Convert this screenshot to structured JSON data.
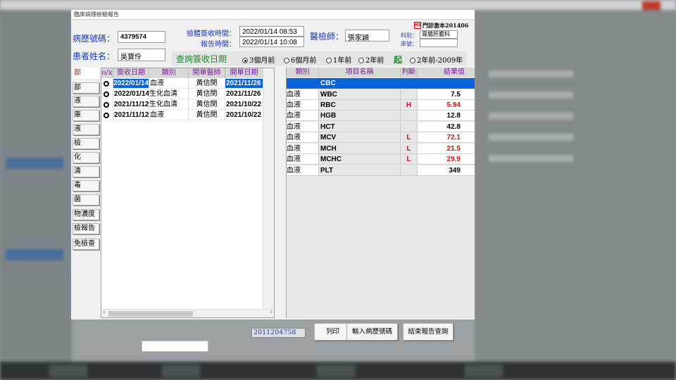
{
  "window": {
    "title": "臨床病理檢驗報告"
  },
  "patient": {
    "chart_no_label": "病歷號碼：",
    "chart_no": "4379574",
    "name_label": "患者姓名：",
    "name": "吳寶伶"
  },
  "times": {
    "received_label": "檢體簽收時間：",
    "received": "2022/01/14 08:53",
    "report_label": "報告時間：",
    "report": "2022/01/14 10:08"
  },
  "doctor": {
    "label": "醫檢師：",
    "value": "張家穎"
  },
  "clinic": {
    "badge": "HS",
    "version": "門診激本201406",
    "dept_label": "科別：",
    "dept": "胃腸肝膽科",
    "bed_label": "床號：",
    "bed": ""
  },
  "query": {
    "title": "查詢簽收日期",
    "options": [
      "3個月前",
      "6個月前",
      "1年前",
      "2年前"
    ],
    "from_label": "起",
    "option_old": "2年前-2009年",
    "selected_index": 0
  },
  "categories": [
    "部",
    "部",
    "液",
    "庫",
    "液",
    "檢",
    "化",
    "清",
    "毒",
    "菌",
    "物濃度",
    "檢報告",
    "免檢查"
  ],
  "left_grid": {
    "headers": [
      "o/x",
      "簽收日期",
      "類別",
      "開單醫師",
      "開單日期"
    ],
    "rows": [
      {
        "mark": "",
        "date": "2022/01/14",
        "type": "血液",
        "doctor": "黃信閔",
        "order_date": "2021/11/26"
      },
      {
        "mark": "",
        "date": "2022/01/14",
        "type": "生化血清",
        "doctor": "黃信閔",
        "order_date": "2021/11/26"
      },
      {
        "mark": "",
        "date": "2021/11/12",
        "type": "生化血清",
        "doctor": "黃信閔",
        "order_date": "2021/10/22"
      },
      {
        "mark": "",
        "date": "2021/11/12",
        "type": "血液",
        "doctor": "黃信閔",
        "order_date": "2021/10/22"
      }
    ]
  },
  "right_grid": {
    "headers": [
      "類別",
      "項目名稱",
      "判斷",
      "結果值"
    ],
    "group": "CBC",
    "rows": [
      {
        "type": "血液",
        "item": "WBC",
        "flag": "",
        "value": "7.5"
      },
      {
        "type": "血液",
        "item": "RBC",
        "flag": "H",
        "value": "5.94"
      },
      {
        "type": "血液",
        "item": "HGB",
        "flag": "",
        "value": "12.8"
      },
      {
        "type": "血液",
        "item": "HCT",
        "flag": "",
        "value": "42.8"
      },
      {
        "type": "血液",
        "item": "MCV",
        "flag": "L",
        "value": "72.1"
      },
      {
        "type": "血液",
        "item": "MCH",
        "flag": "L",
        "value": "21.5"
      },
      {
        "type": "血液",
        "item": "MCHC",
        "flag": "L",
        "value": "29.9"
      },
      {
        "type": "血液",
        "item": "PLT",
        "flag": "",
        "value": "349"
      }
    ]
  },
  "footer": {
    "version_code": "2011204758",
    "print_label": "列印",
    "input_chart_label": "輸入病歷號碼",
    "end_label": "結束報告查詢"
  },
  "colors": {
    "accent": "#0a63d8",
    "abnormal": "#d01010",
    "label": "#1a3ab0",
    "header_text": "#7a1a9a",
    "query_title": "#1a8a2a"
  }
}
